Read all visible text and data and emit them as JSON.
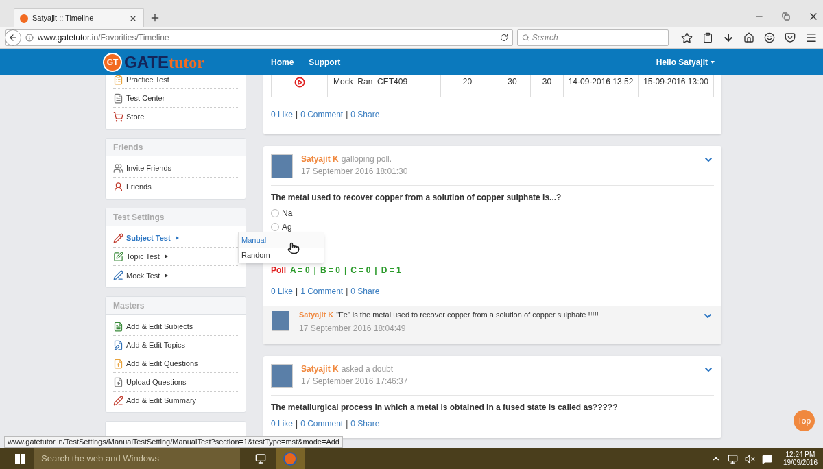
{
  "browser": {
    "tab_title": "Satyajit :: Timeline",
    "url_host": "www.gatetutor.in",
    "url_path": "/Favorities/Timeline",
    "search_placeholder": "Search"
  },
  "header": {
    "logo_mark": "GT",
    "logo_word": "GATE",
    "logo_suffix": "tutor",
    "nav": [
      "Home",
      "Support"
    ],
    "user": "Hello Satyajit"
  },
  "sidebar": [
    {
      "items": [
        {
          "label": "Practice Test",
          "selected": false,
          "kind": "link"
        },
        {
          "label": "Test Center",
          "selected": false,
          "kind": "link"
        },
        {
          "label": "Store",
          "selected": false,
          "kind": "link"
        }
      ]
    },
    {
      "title": "Friends",
      "items": [
        {
          "label": "Invite Friends",
          "selected": false,
          "kind": "link"
        },
        {
          "label": "Friends",
          "selected": false,
          "kind": "link"
        }
      ]
    },
    {
      "title": "Test Settings",
      "items": [
        {
          "label": "Subject Test",
          "selected": true,
          "kind": "submenu"
        },
        {
          "label": "Topic Test",
          "selected": false,
          "kind": "submenu"
        },
        {
          "label": "Mock Test",
          "selected": false,
          "kind": "submenu"
        }
      ]
    },
    {
      "title": "Masters",
      "items": [
        {
          "label": "Add & Edit Subjects",
          "selected": false,
          "kind": "link"
        },
        {
          "label": "Add & Edit Topics",
          "selected": false,
          "kind": "link"
        },
        {
          "label": "Add & Edit Questions",
          "selected": false,
          "kind": "link"
        },
        {
          "label": "Upload Questions",
          "selected": false,
          "kind": "link"
        },
        {
          "label": "Add & Edit Summary",
          "selected": false,
          "kind": "link"
        }
      ]
    }
  ],
  "submenu": [
    {
      "label": "Manual",
      "selected": true
    },
    {
      "label": "Random",
      "selected": false
    }
  ],
  "posts": [
    {
      "kind": "test",
      "row": [
        "Mock_Ran_CET409",
        "20",
        "30",
        "30",
        "14-09-2016 13:52",
        "15-09-2016 13:00"
      ],
      "links": [
        "0 Like",
        "0 Comment",
        "0 Share"
      ]
    },
    {
      "kind": "poll",
      "author": "Satyajit K",
      "action": "galloping poll.",
      "time": "17 September 2016 18:01:30",
      "question": "The metal used to recover copper from a solution of copper sulphate is...?",
      "options": [
        {
          "label": "Na",
          "selected": false
        },
        {
          "label": "Ag",
          "selected": false
        }
      ],
      "result_label": "Poll",
      "results": [
        "A = 0",
        "B = 0",
        "C = 0",
        "D = 1"
      ],
      "links": [
        "0 Like",
        "1 Comment",
        "0 Share"
      ],
      "comment": {
        "author": "Satyajit K",
        "text": "\"Fe\" is the metal used to recover copper from a solution of copper sulphate !!!!!",
        "time": "17 September 2016 18:04:49"
      }
    },
    {
      "kind": "doubt",
      "author": "Satyajit K",
      "action": "asked a doubt",
      "time": "17 September 2016 17:46:37",
      "question": "The metallurgical process in which a metal is obtained in a fused state is called as?????",
      "links": [
        "0 Like",
        "0 Comment",
        "0 Share"
      ]
    }
  ],
  "separator": "|",
  "top_button": "Top",
  "status_url": "www.gatetutor.in/TestSettings/ManualTestSetting/ManualTest?section=1&testType=mst&mode=Add",
  "taskbar": {
    "search_placeholder": "Search the web and Windows",
    "time": "12:24 PM",
    "date": "19/09/2016"
  }
}
